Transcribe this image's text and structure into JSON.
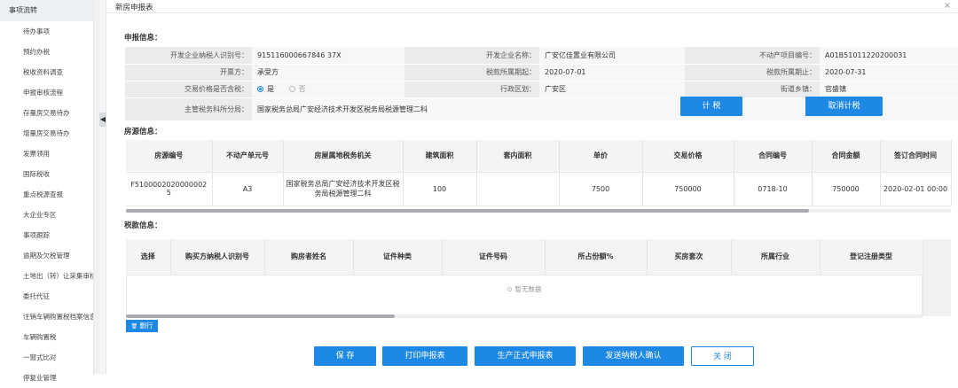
{
  "sidebar": {
    "header": "事项流转",
    "items": [
      "待办事项",
      "预约办税",
      "税收资料调查",
      "申报审核流程",
      "存量房交易待办",
      "增量房交易待办",
      "发票领用",
      "国际税收",
      "重点税源查报",
      "大企业专区",
      "事项跟踪",
      "逾期及欠税管理",
      "土地出（转）让采集审核",
      "委托代征",
      "注销车辆购置税档案信息",
      "车辆购置税",
      "一窗式比对",
      "停复业管理"
    ]
  },
  "dialog": {
    "title": "新房申报表",
    "close_icon": "×"
  },
  "declare": {
    "section": "申报信息：",
    "rows": [
      [
        {
          "label": "开发企业纳税人识别号：",
          "value": "915116000667846 37X"
        },
        {
          "label": "开发企业名称：",
          "value": "广安亿佳置业有限公司"
        },
        {
          "label": "不动产项目编号：",
          "value": "A01B51011220200031"
        }
      ],
      [
        {
          "label": "开票方：",
          "value": "承受方"
        },
        {
          "label": "税款所属期起：",
          "value": "2020-07-01"
        },
        {
          "label": "税款所属期止：",
          "value": "2020-07-31"
        }
      ],
      [
        {
          "label": "交易价格是否含税：",
          "value": ""
        },
        {
          "label": "行政区划：",
          "value": "广安区"
        },
        {
          "label": "街道乡镇：",
          "value": "官盛镇"
        }
      ]
    ],
    "radio_yes": "是",
    "radio_no": "否",
    "tax_office_label": "主管税务科所分局：",
    "tax_office_value": "国家税务总局广安经济技术开发区税务局税源管理二科",
    "calc_button": "计 税",
    "cancel_calc_button": "取消计税"
  },
  "house": {
    "section": "房源信息：",
    "columns": [
      "房源编号",
      "不动产单元号",
      "房屋属地税务机关",
      "建筑面积",
      "套内面积",
      "单价",
      "交易价格",
      "合同编号",
      "合同金额",
      "签订合同时间"
    ],
    "rows": [
      [
        "F5100002020000002 5",
        "A3",
        "国家税务总局广安经济技术开发区税务局税源管理二科",
        "100",
        "",
        "7500",
        "750000",
        "0718-10",
        "750000",
        "2020-02-01 00:00"
      ]
    ]
  },
  "tax": {
    "section": "税款信息：",
    "columns": [
      "选择",
      "购买方纳税人识别号",
      "购房者姓名",
      "证件种类",
      "证件号码",
      "所占份额%",
      "买房套次",
      "所属行业",
      "登记注册类型"
    ],
    "empty_text": "暂无数据",
    "empty_icon": "⊙",
    "delete_button": "删行",
    "delete_icon": "🗑"
  },
  "footer": {
    "save": "保 存",
    "print": "打印申报表",
    "generate": "生产正式申报表",
    "send": "发送纳税人确认",
    "close": "关 闭"
  },
  "colors": {
    "accent": "#1e88e5",
    "label_bg": "#e9ebed",
    "header_bg": "#f2f4f6"
  }
}
